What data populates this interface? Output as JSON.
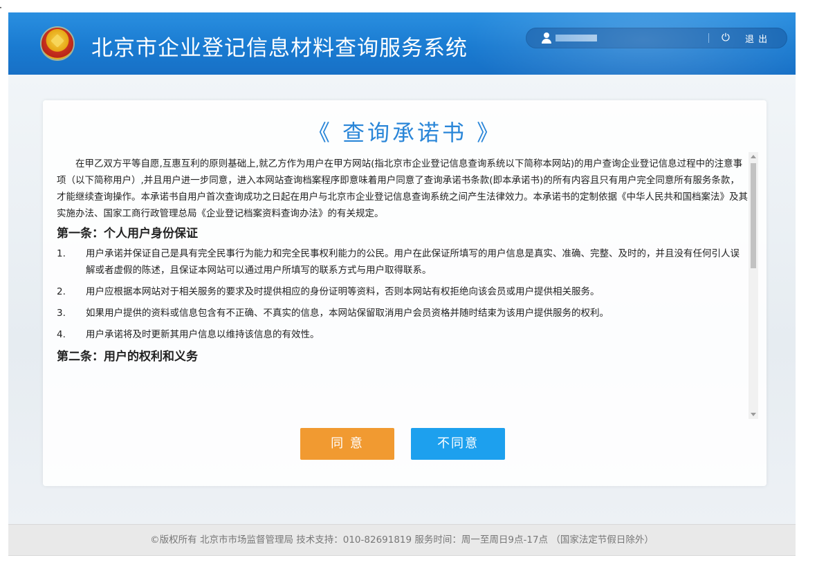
{
  "header": {
    "title": "北京市企业登记信息材料查询服务系统",
    "logout_label": "退 出",
    "colors": {
      "header_blue": "#1a7bd1",
      "title_blue": "#2a86d8"
    }
  },
  "document": {
    "title": "《 查询承诺书 》",
    "intro": "在甲乙双方平等自愿,互惠互利的原则基础上,就乙方作为用户在甲方网站(指北京市企业登记信息查询系统以下简称本网站)的用户查询企业登记信息过程中的注意事项（以下简称用户）,并且用户进一步同意，进入本网站查询档案程序即意味着用户同意了查询承诺书条款(即本承诺书)的所有内容且只有用户完全同意所有服务条款，才能继续查询操作。本承诺书自用户首次查询成功之日起在用户与北京市企业登记信息查询系统之间产生法律效力。本承诺书的定制依据《中华人民共和国档案法》及其实施办法、国家工商行政管理总局《企业登记档案资料查询办法》的有关规定。",
    "section1": {
      "heading": "第一条：个人用户身份保证",
      "items": [
        {
          "num": "1.",
          "text": "用户承诺并保证自己是具有完全民事行为能力和完全民事权利能力的公民。用户在此保证所填写的用户信息是真实、准确、完整、及时的，并且没有任何引人误解或者虚假的陈述，且保证本网站可以通过用户所填写的联系方式与用户取得联系。"
        },
        {
          "num": "2.",
          "text": "用户应根据本网站对于相关服务的要求及时提供相应的身份证明等资料，否则本网站有权拒绝向该会员或用户提供相关服务。"
        },
        {
          "num": "3.",
          "text": "如果用户提供的资料或信息包含有不正确、不真实的信息，本网站保留取消用户会员资格并随时结束为该用户提供服务的权利。"
        },
        {
          "num": "4.",
          "text": "用户承诺将及时更新其用户信息以维持该信息的有效性。"
        }
      ]
    },
    "section2": {
      "heading": "第二条：用户的权利和义务"
    }
  },
  "buttons": {
    "agree": "同 意",
    "disagree": "不同意"
  },
  "footer": {
    "text": "©版权所有 北京市市场监督管理局   技术支持：010-82691819    服务时间：周一至周日9点-17点 （国家法定节假日除外）"
  }
}
